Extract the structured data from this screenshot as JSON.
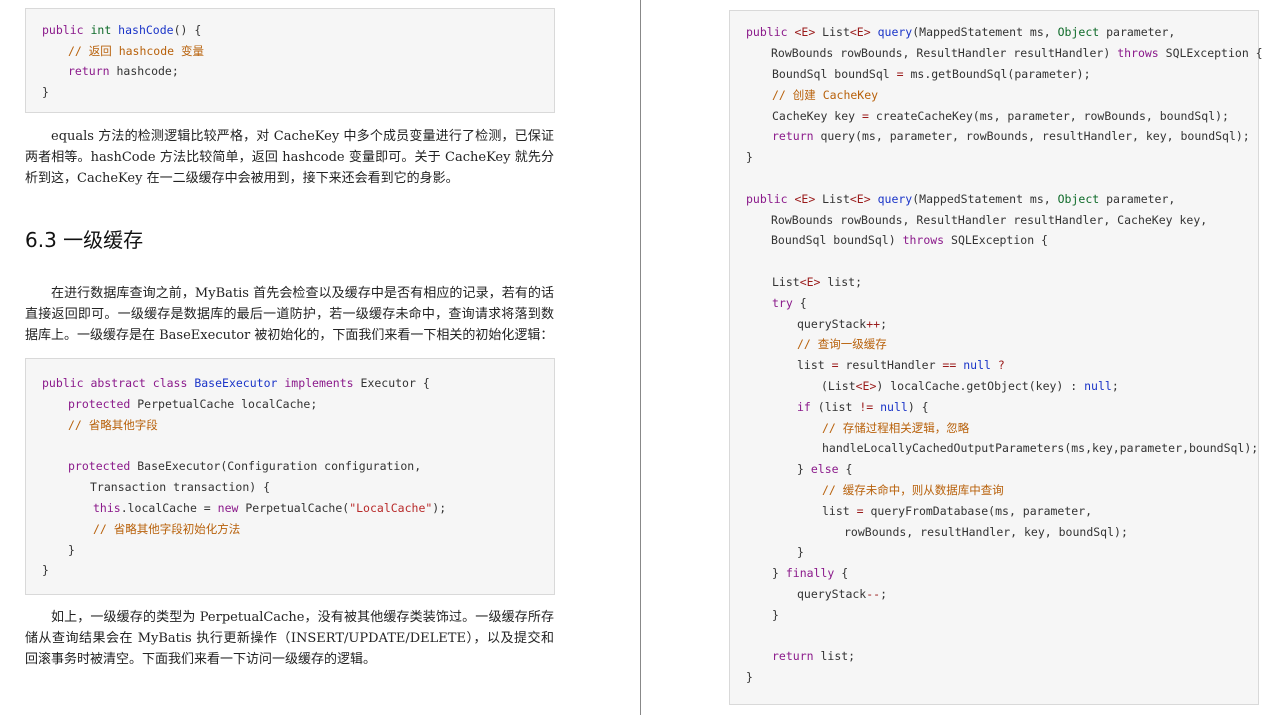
{
  "left": {
    "code_hashcode": {
      "l1": {
        "a": "public ",
        "b": "int ",
        "c": "hashCode",
        "d": "() {"
      },
      "l2": "// 返回 hashcode 变量",
      "l3": {
        "a": "return ",
        "b": "hashcode;"
      },
      "l4": "}"
    },
    "para1": "equals 方法的检测逻辑比较严格，对 CacheKey 中多个成员变量进行了检测，已保证两者相等。hashCode 方法比较简单，返回 hashcode 变量即可。关于 CacheKey 就先分析到这，CacheKey 在一二级缓存中会被用到，接下来还会看到它的身影。",
    "heading": "6.3 一级缓存",
    "para2": "在进行数据库查询之前，MyBatis 首先会检查以及缓存中是否有相应的记录，若有的话直接返回即可。一级缓存是数据库的最后一道防护，若一级缓存未命中，查询请求将落到数据库上。一级缓存是在 BaseExecutor 被初始化的，下面我们来看一下相关的初始化逻辑：",
    "code_executor": {
      "l1": {
        "a": "public abstract class ",
        "b": "BaseExecutor",
        "c": " implements ",
        "d": "Executor {"
      },
      "l2": {
        "a": "protected ",
        "b": "PerpetualCache localCache;"
      },
      "l3": "// 省略其他字段",
      "l4": {
        "a": "protected ",
        "b": "BaseExecutor(Configuration configuration,"
      },
      "l5": "Transaction transaction) {",
      "l6": {
        "a": "this",
        "b": ".localCache = ",
        "c": "new ",
        "d": "PerpetualCache(",
        "e": "\"LocalCache\"",
        "f": ");"
      },
      "l7": "// 省略其他字段初始化方法",
      "l8": "}",
      "l9": "}"
    },
    "para3": "如上，一级缓存的类型为 PerpetualCache，没有被其他缓存类装饰过。一级缓存所存储从查询结果会在 MyBatis 执行更新操作（INSERT/UPDATE/DELETE），以及提交和回滚事务时被清空。下面我们来看一下访问一级缓存的逻辑。"
  },
  "right": {
    "code_query": {
      "l1": {
        "a": "public ",
        "b": "<E>",
        "c": " List",
        "d": "<E>",
        "e": " ",
        "f": "query",
        "g": "(MappedStatement ms, ",
        "h": "Object",
        "i": " parameter,"
      },
      "l2": {
        "a": "RowBounds rowBounds, ResultHandler resultHandler) ",
        "b": "throws",
        "c": " SQLException {"
      },
      "l3": {
        "a": "BoundSql boundSql ",
        "b": "=",
        "c": " ms.getBoundSql(parameter);"
      },
      "l4": "// 创建 CacheKey",
      "l5": {
        "a": "CacheKey key ",
        "b": "=",
        "c": " createCacheKey(ms, parameter, rowBounds, boundSql);"
      },
      "l6": {
        "a": "return ",
        "b": "query(ms, parameter, rowBounds, resultHandler, key, boundSql);"
      },
      "l7": "}",
      "l8": {
        "a": "public ",
        "b": "<E>",
        "c": " List",
        "d": "<E>",
        "e": " ",
        "f": "query",
        "g": "(MappedStatement ms, ",
        "h": "Object",
        "i": " parameter,"
      },
      "l9": "RowBounds rowBounds, ResultHandler resultHandler, CacheKey key,",
      "l10": {
        "a": "BoundSql boundSql) ",
        "b": "throws",
        "c": " SQLException {"
      },
      "l11": {
        "a": "List",
        "b": "<E>",
        "c": " list;"
      },
      "l12": {
        "a": "try",
        "b": " {"
      },
      "l13": {
        "a": "queryStack",
        "b": "++",
        "c": ";"
      },
      "l14": "// 查询一级缓存",
      "l15": {
        "a": "list ",
        "b": "=",
        "c": " resultHandler ",
        "d": "==",
        "e": " ",
        "f": "null",
        "g": " ?"
      },
      "l16": {
        "a": "(List",
        "b": "<E>",
        "c": ") localCache.getObject(key) : ",
        "d": "null",
        "e": ";"
      },
      "l17": {
        "a": "if",
        "b": " (list ",
        "c": "!=",
        "d": " ",
        "e": "null",
        "f": ") {"
      },
      "l18": "// 存储过程相关逻辑，忽略",
      "l19": "handleLocallyCachedOutputParameters(ms,key,parameter,boundSql);",
      "l20": {
        "a": "} ",
        "b": "else",
        "c": " {"
      },
      "l21": "// 缓存未命中，则从数据库中查询",
      "l22": {
        "a": "list ",
        "b": "=",
        "c": " queryFromDatabase(ms, parameter,"
      },
      "l23": "rowBounds, resultHandler, key, boundSql);",
      "l24": "}",
      "l25": {
        "a": "} ",
        "b": "finally",
        "c": " {"
      },
      "l26": {
        "a": "queryStack",
        "b": "--",
        "c": ";"
      },
      "l27": "}",
      "l28": {
        "a": "return ",
        "b": "list;"
      },
      "l29": "}"
    }
  }
}
